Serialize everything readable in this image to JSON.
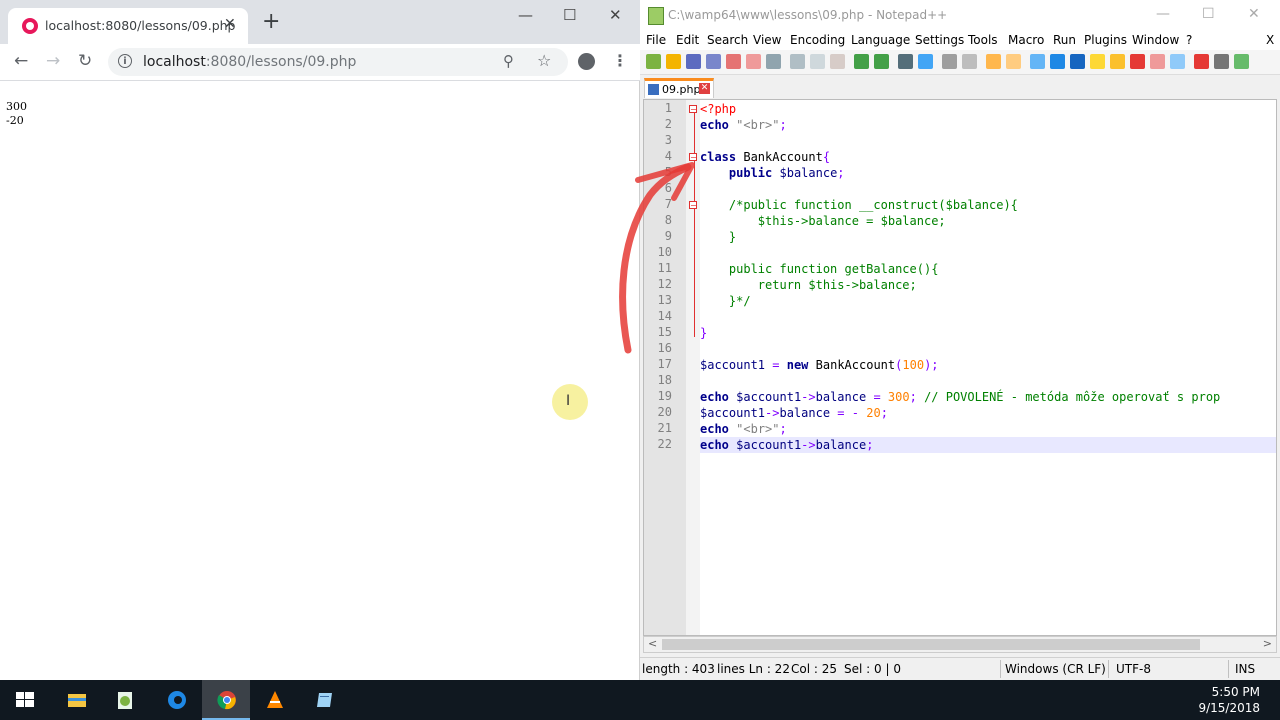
{
  "browser": {
    "tab_title": "localhost:8080/lessons/09.php",
    "tab_close": "✕",
    "new_tab": "+",
    "url_host": "localhost",
    "url_rest": ":8080/lessons/09.php",
    "output_lines": [
      "300",
      "-20"
    ]
  },
  "notepad": {
    "title": "C:\\wamp64\\www\\lessons\\09.php - Notepad++",
    "menu": [
      "File",
      "Edit",
      "Search",
      "View",
      "Encoding",
      "Language",
      "Settings",
      "Tools",
      "Macro",
      "Run",
      "Plugins",
      "Window",
      "?"
    ],
    "close_x": "X",
    "file_tab": "09.php",
    "line_numbers": [
      "1",
      "2",
      "3",
      "4",
      "5",
      "6",
      "7",
      "8",
      "9",
      "10",
      "11",
      "12",
      "13",
      "14",
      "15",
      "16",
      "17",
      "18",
      "19",
      "20",
      "21",
      "22"
    ],
    "current_line": 22,
    "status": {
      "length": "length : 403",
      "lines": "lines Ln : 22",
      "col": "Col : 25",
      "sel": "Sel : 0 | 0",
      "eol": "Windows (CR LF)",
      "encoding": "UTF-8",
      "mode": "INS"
    }
  },
  "taskbar": {
    "time": "5:50 PM",
    "date": "9/15/2018",
    "apps": [
      "windows-start-icon",
      "file-explorer-icon",
      "notepad-plus-plus-icon",
      "edge-icon",
      "chrome-icon",
      "vlc-icon",
      "notepad-icon"
    ]
  }
}
